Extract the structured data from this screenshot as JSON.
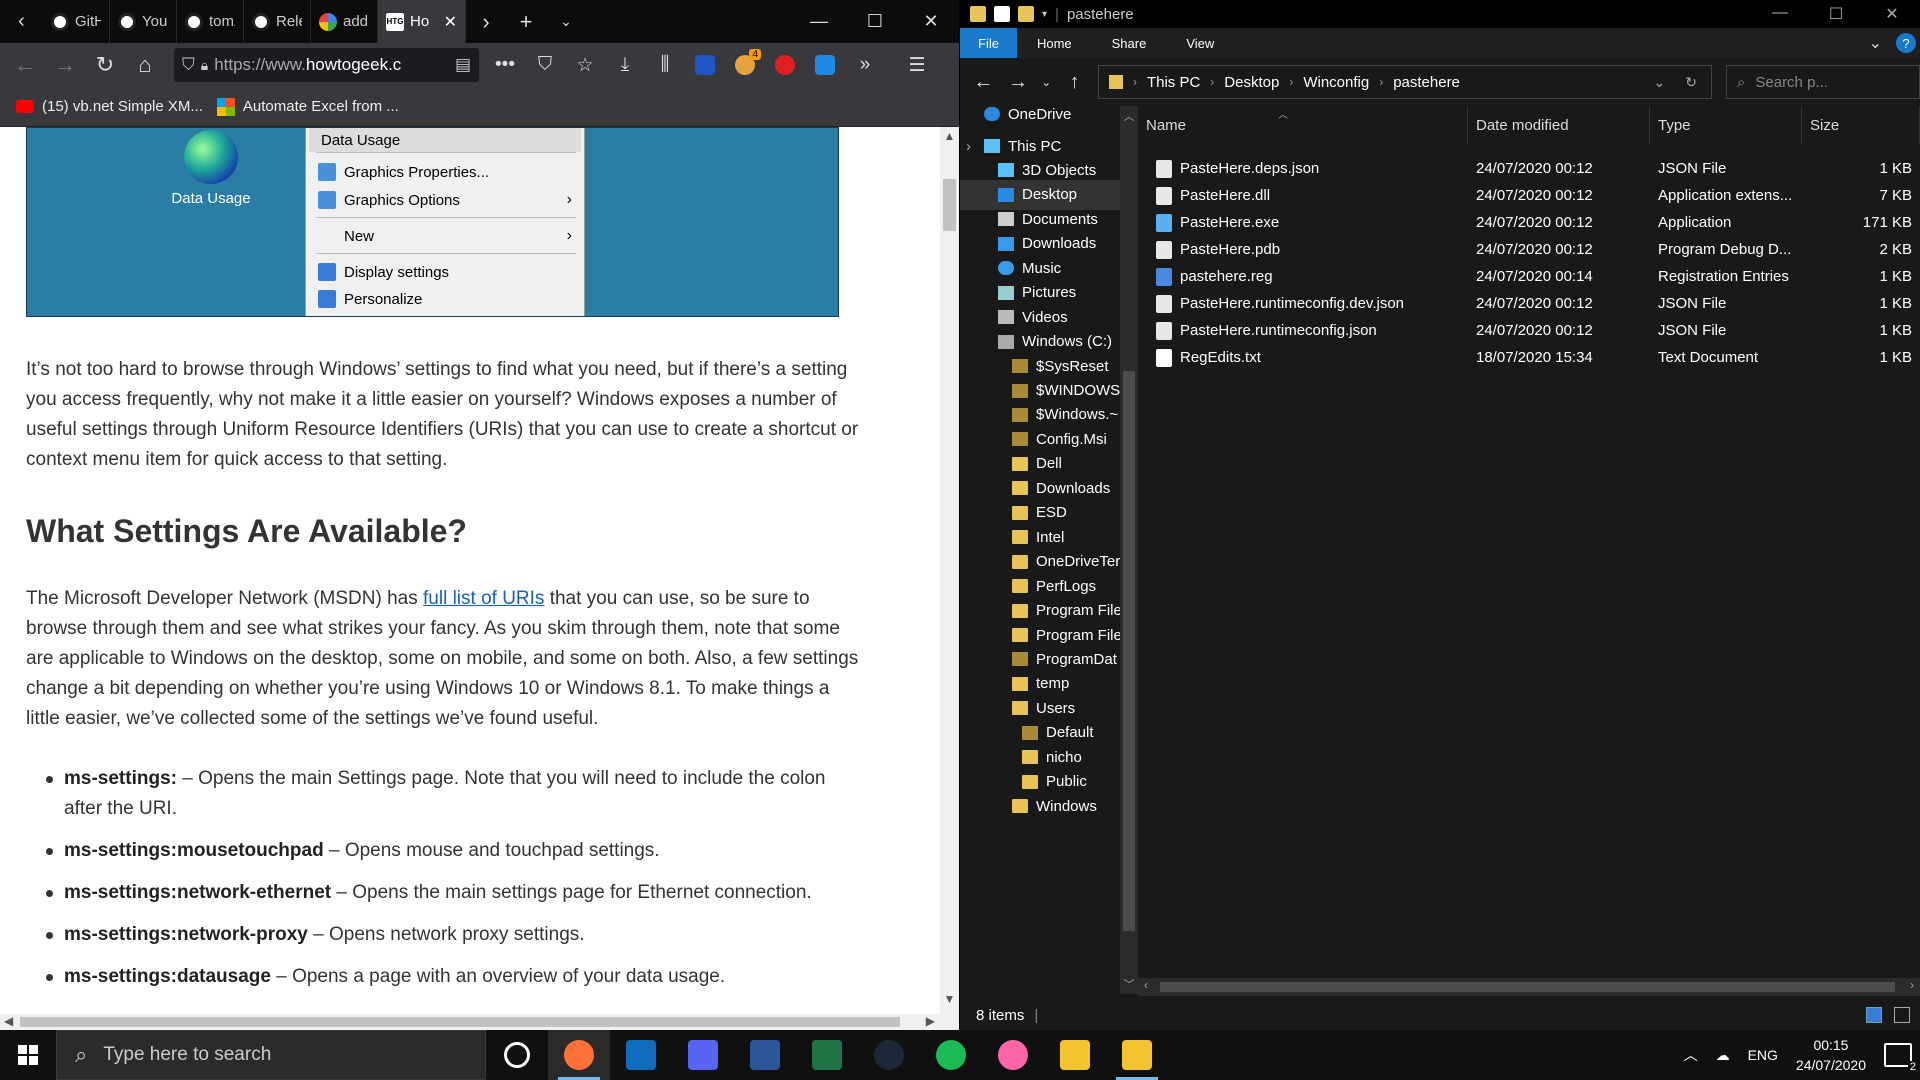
{
  "firefox": {
    "tabs": [
      {
        "label": "GitHu",
        "icon": "github-icon"
      },
      {
        "label": "Your S",
        "icon": "github-icon"
      },
      {
        "label": "tomzo",
        "icon": "github-icon"
      },
      {
        "label": "Releas",
        "icon": "github-icon"
      },
      {
        "label": "add sh",
        "icon": "google-icon"
      },
      {
        "label": "Ho",
        "icon": "htg-icon",
        "active": true
      }
    ],
    "url_prefix": "https://www.",
    "url_host": "howtogeek.c",
    "addon_badge": "4",
    "bookmarks": [
      {
        "label": "(15) vb.net Simple XM...",
        "icon": "youtube-icon"
      },
      {
        "label": "Automate Excel from ...",
        "icon": "microsoft-icon"
      }
    ],
    "article": {
      "image": {
        "desktop_icon_label": "Data Usage",
        "menu_items": [
          {
            "label": "Data Usage",
            "highlight": true
          },
          {
            "label": "Graphics Properties..."
          },
          {
            "label": "Graphics Options",
            "submenu": true
          },
          {
            "label": "New",
            "submenu": true
          },
          {
            "label": "Display settings"
          },
          {
            "label": "Personalize"
          }
        ]
      },
      "para1": "It’s not too hard to browse through Windows’ settings to find what you need, but if there’s a setting you access frequently, why not make it a little easier on yourself? Windows exposes a number of useful settings through Uniform Resource Identifiers (URIs) that you can use to create a shortcut or context menu item for quick access to that setting.",
      "heading": "What Settings Are Available?",
      "para2_before": "The Microsoft Developer Network (MSDN) has ",
      "para2_link": "full list of URIs",
      "para2_after": " that you can use, so be sure to browse through them and see what strikes your fancy. As you skim through them, note that some are applicable to Windows on the desktop, some on mobile, and some on both. Also, a few settings change a bit depending on whether you’re using Windows 10 or Windows 8.1. To make things a little easier, we’ve collected some of the settings we’ve found useful.",
      "list": [
        {
          "key": "ms-settings:",
          "desc": " – Opens the main Settings page. Note that you will need to include the colon after the URI."
        },
        {
          "key": "ms-settings:mousetouchpad",
          "desc": " – Opens mouse and touchpad settings."
        },
        {
          "key": "ms-settings:network-ethernet",
          "desc": " – Opens the main settings page for Ethernet connection."
        },
        {
          "key": "ms-settings:network-proxy",
          "desc": " – Opens network proxy settings."
        },
        {
          "key": "ms-settings:datausage",
          "desc": " – Opens a page with an overview of your data usage."
        }
      ]
    }
  },
  "explorer": {
    "title": "pastehere",
    "ribbon_tabs": [
      "File",
      "Home",
      "Share",
      "View"
    ],
    "breadcrumb": [
      "This PC",
      "Desktop",
      "Winconfig",
      "pastehere"
    ],
    "search_placeholder": "Search p...",
    "nav": [
      {
        "label": "OneDrive",
        "icon": "cloud",
        "indent": 0
      },
      {
        "label": "This PC",
        "icon": "pc",
        "indent": 0
      },
      {
        "label": "3D Objects",
        "icon": "pc",
        "indent": 1
      },
      {
        "label": "Desktop",
        "icon": "desk",
        "indent": 1,
        "selected": true
      },
      {
        "label": "Documents",
        "icon": "docs",
        "indent": 1
      },
      {
        "label": "Downloads",
        "icon": "down",
        "indent": 1
      },
      {
        "label": "Music",
        "icon": "music",
        "indent": 1
      },
      {
        "label": "Pictures",
        "icon": "pics",
        "indent": 1
      },
      {
        "label": "Videos",
        "icon": "vids",
        "indent": 1
      },
      {
        "label": "Windows (C:)",
        "icon": "drive",
        "indent": 1
      },
      {
        "label": "$SysReset",
        "icon": "fold-dark",
        "indent": 2
      },
      {
        "label": "$WINDOWS.",
        "icon": "fold-dark",
        "indent": 2
      },
      {
        "label": "$Windows.~",
        "icon": "fold-dark",
        "indent": 2
      },
      {
        "label": "Config.Msi",
        "icon": "fold-dark",
        "indent": 2
      },
      {
        "label": "Dell",
        "icon": "folder",
        "indent": 2
      },
      {
        "label": "Downloads",
        "icon": "folder",
        "indent": 2
      },
      {
        "label": "ESD",
        "icon": "folder",
        "indent": 2
      },
      {
        "label": "Intel",
        "icon": "folder",
        "indent": 2
      },
      {
        "label": "OneDriveTer",
        "icon": "folder",
        "indent": 2
      },
      {
        "label": "PerfLogs",
        "icon": "folder",
        "indent": 2
      },
      {
        "label": "Program File",
        "icon": "folder",
        "indent": 2
      },
      {
        "label": "Program File",
        "icon": "folder",
        "indent": 2
      },
      {
        "label": "ProgramDat",
        "icon": "fold-dark",
        "indent": 2
      },
      {
        "label": "temp",
        "icon": "folder",
        "indent": 2
      },
      {
        "label": "Users",
        "icon": "folder",
        "indent": 2
      },
      {
        "label": "Default",
        "icon": "fold-dark",
        "indent": 3
      },
      {
        "label": "nicho",
        "icon": "folder",
        "indent": 3
      },
      {
        "label": "Public",
        "icon": "folder",
        "indent": 3
      },
      {
        "label": "Windows",
        "icon": "folder",
        "indent": 2
      }
    ],
    "columns": [
      "Name",
      "Date modified",
      "Type",
      "Size"
    ],
    "files": [
      {
        "name": "PasteHere.deps.json",
        "date": "24/07/2020 00:12",
        "type": "JSON File",
        "size": "1 KB",
        "icon": "json"
      },
      {
        "name": "PasteHere.dll",
        "date": "24/07/2020 00:12",
        "type": "Application extens...",
        "size": "7 KB",
        "icon": "dll"
      },
      {
        "name": "PasteHere.exe",
        "date": "24/07/2020 00:12",
        "type": "Application",
        "size": "171 KB",
        "icon": "exe"
      },
      {
        "name": "PasteHere.pdb",
        "date": "24/07/2020 00:12",
        "type": "Program Debug D...",
        "size": "2 KB",
        "icon": "pdb"
      },
      {
        "name": "pastehere.reg",
        "date": "24/07/2020 00:14",
        "type": "Registration Entries",
        "size": "1 KB",
        "icon": "reg"
      },
      {
        "name": "PasteHere.runtimeconfig.dev.json",
        "date": "24/07/2020 00:12",
        "type": "JSON File",
        "size": "1 KB",
        "icon": "json"
      },
      {
        "name": "PasteHere.runtimeconfig.json",
        "date": "24/07/2020 00:12",
        "type": "JSON File",
        "size": "1 KB",
        "icon": "json"
      },
      {
        "name": "RegEdits.txt",
        "date": "18/07/2020 15:34",
        "type": "Text Document",
        "size": "1 KB",
        "icon": "txt"
      }
    ],
    "status": "8 items"
  },
  "taskbar": {
    "search_placeholder": "Type here to search",
    "apps": [
      "cortana",
      "firefox",
      "outlook",
      "discord",
      "word",
      "excel",
      "steam",
      "spotify",
      "osu",
      "file-explorer-beta",
      "file-explorer"
    ],
    "app_colors": {
      "cortana": "#101010",
      "firefox": "#ff7139",
      "outlook": "#0f6cbd",
      "discord": "#5865f2",
      "word": "#2b579a",
      "excel": "#217346",
      "steam": "#1b2838",
      "spotify": "#1db954",
      "osu": "#ff66aa",
      "file-explorer-beta": "#f4c430",
      "file-explorer": "#f4c430"
    },
    "lang": "ENG",
    "time": "00:15",
    "date": "24/07/2020",
    "notif_count": "2"
  }
}
